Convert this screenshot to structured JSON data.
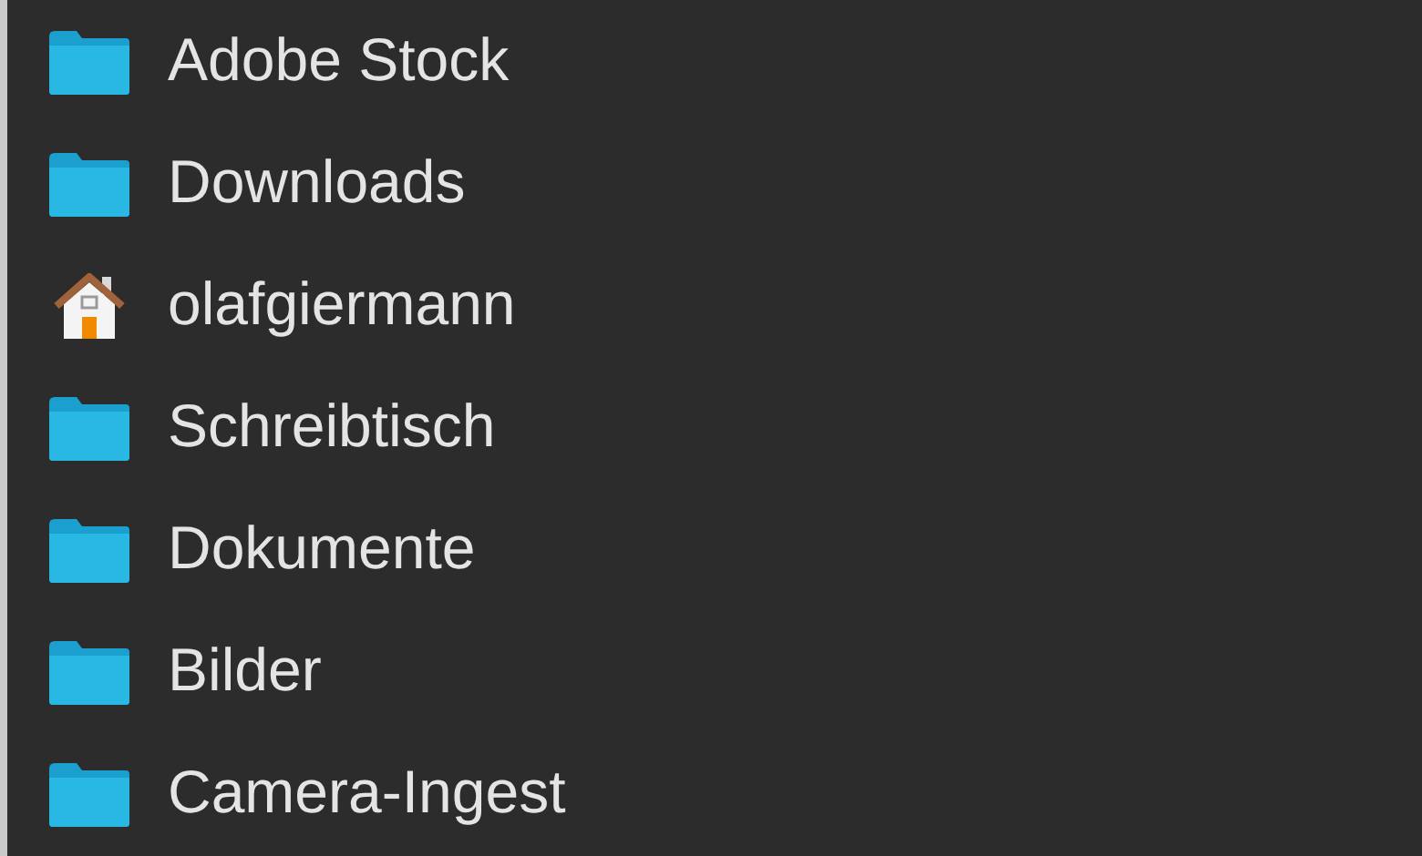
{
  "sidebar": {
    "items": [
      {
        "label": "Adobe Stock",
        "kind": "folder"
      },
      {
        "label": "Downloads",
        "kind": "folder"
      },
      {
        "label": "olafgiermann",
        "kind": "home"
      },
      {
        "label": "Schreibtisch",
        "kind": "folder"
      },
      {
        "label": "Dokumente",
        "kind": "folder"
      },
      {
        "label": "Bilder",
        "kind": "folder"
      },
      {
        "label": "Camera-Ingest",
        "kind": "folder"
      }
    ]
  }
}
